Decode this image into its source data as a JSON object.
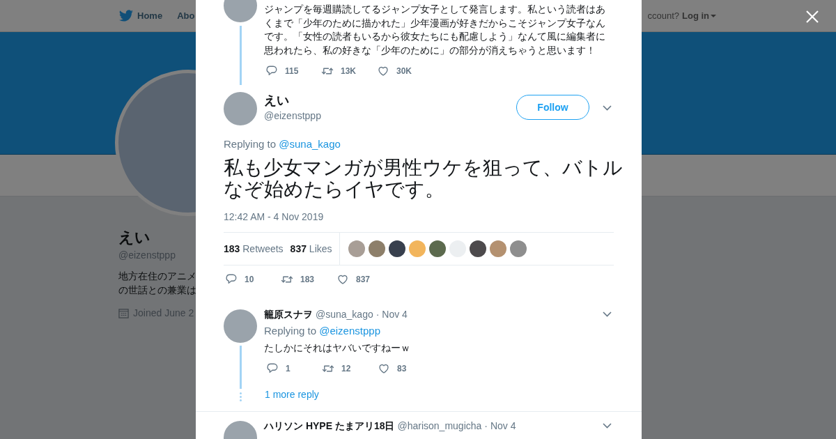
{
  "background_page": {
    "nav": {
      "home": "Home",
      "about": "Abo",
      "account_prompt": "ccount?",
      "login": "Log in"
    },
    "profile": {
      "name": "えい",
      "handle": "@eizenstppp",
      "bio_lines": [
        "地方在住のアニメ",
        "の世話との兼業は"
      ],
      "joined": "Joined June 2"
    }
  },
  "tweets": [
    {
      "kind": "previous",
      "text": "ジャンプを毎週購読してるジャンプ女子として発言します。私という読者はあくまで「少年のために描かれた」少年漫画が好きだからこそジャンプ女子なんです。「女性の読者もいるから彼女たちにも配慮しよう」なんて風に編集者に思われたら、私の好きな「少年のために」の部分が消えちゃうと思います！",
      "replies": "115",
      "retweets": "13K",
      "likes": "30K"
    },
    {
      "kind": "focused",
      "name": "えい",
      "handle": "@eizenstppp",
      "follow": "Follow",
      "replying_prefix": "Replying to",
      "replying_to": "@suna_kago",
      "text": "私も少女マンガが男性ウケを狙って、バトルなぞ始めたらイヤです。",
      "time": "12:42 AM - 4 Nov 2019",
      "retweets_stat": "**183** Retweets",
      "likes_stat": "**837** Likes",
      "replies": "10",
      "retweets": "183",
      "likes": "837"
    },
    {
      "kind": "reply",
      "name": "籠原スナヲ",
      "handle": "@suna_kago",
      "date": "· Nov 4",
      "replying_prefix": "Replying to",
      "replying_to": "@eizenstppp",
      "text": "たしかにそれはヤバいですねーｗ",
      "replies": "1",
      "retweets": "12",
      "likes": "83",
      "more_replies": "1 more reply"
    },
    {
      "kind": "next",
      "name": "ハリソン HYPE たまアリ18日",
      "handle": "@harison_mugicha",
      "date": "· Nov 4"
    }
  ]
}
